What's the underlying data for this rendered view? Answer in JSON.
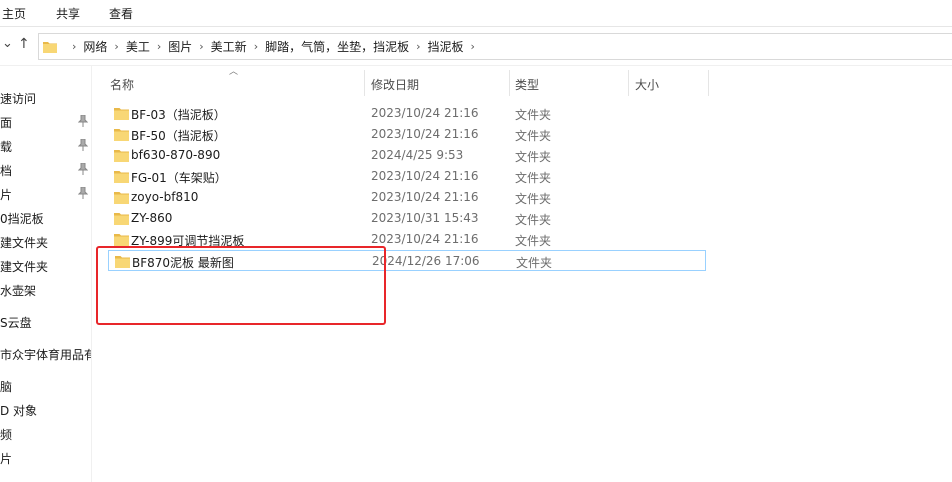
{
  "ribbon": {
    "tabs": [
      "主页",
      "共享",
      "查看"
    ]
  },
  "address": {
    "crumbs": [
      "网络",
      "美工",
      "图片",
      "美工新",
      "脚踏，气筒，坐垫，挡泥板",
      "挡泥板"
    ]
  },
  "sidebar": {
    "items": [
      {
        "label": "速访问",
        "pinned": false
      },
      {
        "label": "面",
        "pinned": true
      },
      {
        "label": "载",
        "pinned": true
      },
      {
        "label": "档",
        "pinned": true
      },
      {
        "label": "片",
        "pinned": true
      },
      {
        "label": "0挡泥板",
        "pinned": false
      },
      {
        "label": "建文件夹",
        "pinned": false
      },
      {
        "label": "建文件夹",
        "pinned": false
      },
      {
        "label": "水壶架",
        "pinned": false
      },
      {
        "label": "S云盘",
        "pinned": false
      },
      {
        "label": "市众宇体育用品有",
        "pinned": false
      },
      {
        "label": "脑",
        "pinned": false
      },
      {
        "label": "D 对象",
        "pinned": false
      },
      {
        "label": "频",
        "pinned": false
      },
      {
        "label": "片",
        "pinned": false
      }
    ]
  },
  "columns": {
    "name": "名称",
    "date": "修改日期",
    "type": "类型",
    "size": "大小"
  },
  "files": [
    {
      "name": "BF-03（挡泥板）",
      "date": "2023/10/24 21:16",
      "type": "文件夹"
    },
    {
      "name": "BF-50（挡泥板）",
      "date": "2023/10/24 21:16",
      "type": "文件夹"
    },
    {
      "name": "bf630-870-890",
      "date": "2024/4/25 9:53",
      "type": "文件夹"
    },
    {
      "name": "FG-01（车架贴）",
      "date": "2023/10/24 21:16",
      "type": "文件夹"
    },
    {
      "name": "zoyo-bf810",
      "date": "2023/10/24 21:16",
      "type": "文件夹"
    },
    {
      "name": "ZY-860",
      "date": "2023/10/31 15:43",
      "type": "文件夹"
    },
    {
      "name": "ZY-899可调节挡泥板",
      "date": "2023/10/24 21:16",
      "type": "文件夹"
    },
    {
      "name": "BF870泥板 最新图",
      "date": "2024/12/26 17:06",
      "type": "文件夹",
      "selected": true
    }
  ],
  "colors": {
    "accent_selection_border": "#99d1ff",
    "annotation_red": "#e8262a",
    "folder_yellow": "#f8d775"
  },
  "icons": {
    "folder": "folder-icon",
    "pin": "pin-icon",
    "up": "up-arrow-icon",
    "back": "chevron-down-icon",
    "sort": "sort-ascending-icon"
  }
}
